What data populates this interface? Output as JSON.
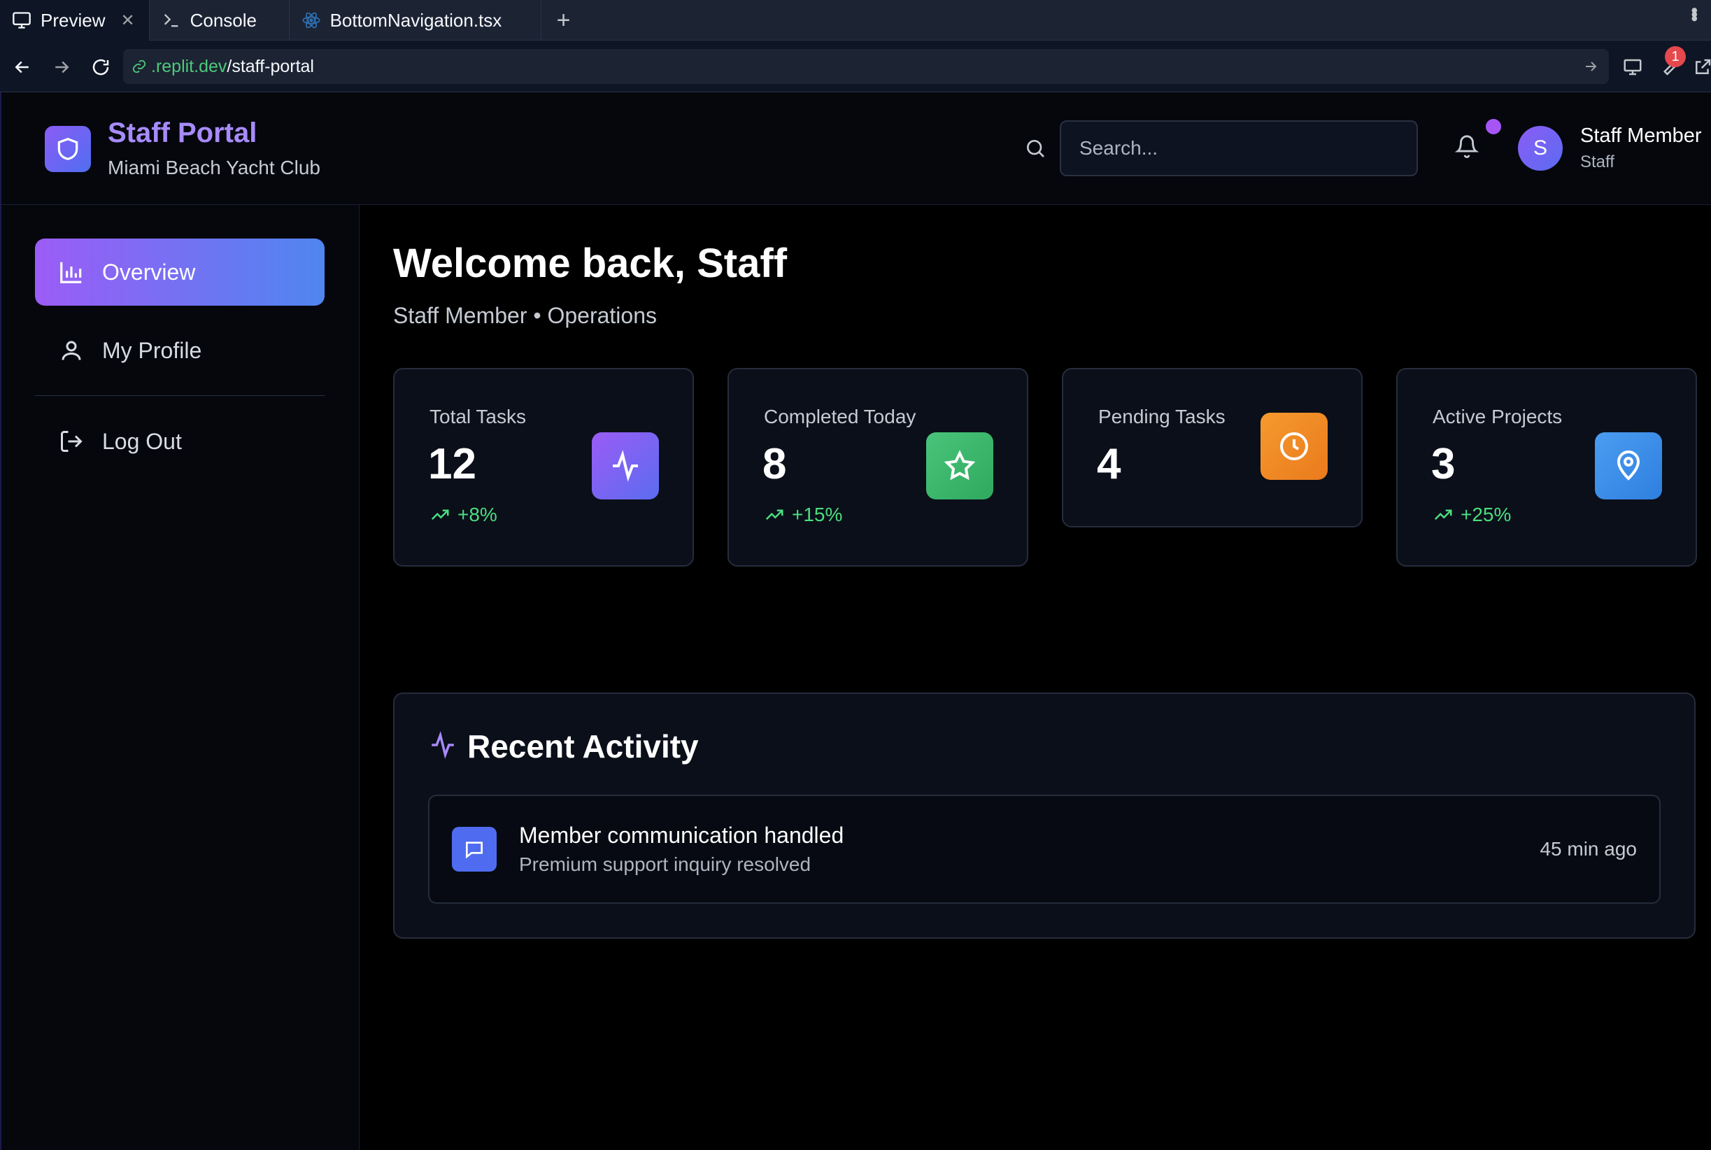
{
  "browser": {
    "tabs": [
      {
        "label": "Preview",
        "icon": "monitor-icon",
        "active": true
      },
      {
        "label": "Console",
        "icon": "terminal-icon",
        "active": false
      },
      {
        "label": "BottomNavigation.tsx",
        "icon": "react-icon",
        "active": false
      }
    ],
    "url_host": ".replit.dev",
    "url_path": "/staff-portal",
    "badge_count": "1"
  },
  "header": {
    "title": "Staff Portal",
    "subtitle": "Miami Beach Yacht Club",
    "search_placeholder": "Search...",
    "avatar_letter": "S",
    "user_name": "Staff Member",
    "user_role": "Staff"
  },
  "sidebar": {
    "items": [
      {
        "label": "Overview",
        "icon": "bar-chart-icon",
        "active": true
      },
      {
        "label": "My Profile",
        "icon": "user-icon",
        "active": false
      },
      {
        "label": "Log Out",
        "icon": "logout-icon",
        "active": false
      }
    ]
  },
  "main": {
    "welcome": "Welcome back, Staff",
    "subtitle": "Staff Member • Operations",
    "stats": [
      {
        "label": "Total Tasks",
        "value": "12",
        "trend": "+8%",
        "icon": "activity-icon",
        "color": "#7c5cf5"
      },
      {
        "label": "Completed Today",
        "value": "8",
        "trend": "+15%",
        "icon": "star-icon",
        "color": "#3fb86a"
      },
      {
        "label": "Pending Tasks",
        "value": "4",
        "trend": "",
        "icon": "clock-icon",
        "color": "#f08a24"
      },
      {
        "label": "Active Projects",
        "value": "3",
        "trend": "+25%",
        "icon": "map-pin-icon",
        "color": "#3b8ee8"
      }
    ],
    "activity": {
      "title": "Recent Activity",
      "items": [
        {
          "title": "Member communication handled",
          "subtitle": "Premium support inquiry resolved",
          "time": "45 min ago",
          "icon": "message-icon"
        }
      ]
    }
  },
  "colors": {
    "accent_purple": "#a78bfa",
    "gradient_start": "#9b5cf6",
    "gradient_end": "#4f86f0",
    "trend_green": "#4ade80"
  }
}
